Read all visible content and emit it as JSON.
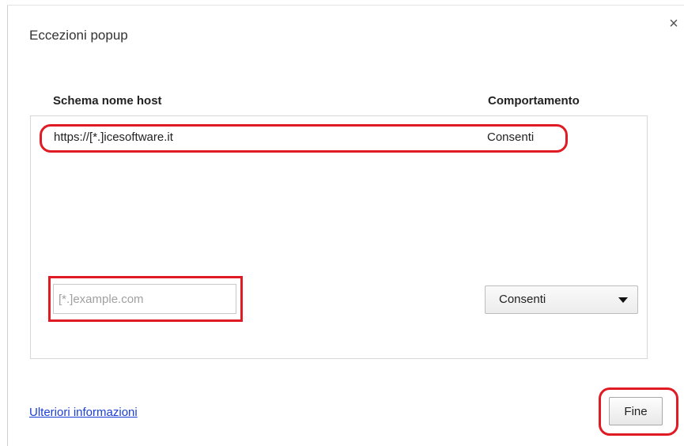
{
  "dialog": {
    "title": "Eccezioni popup",
    "close_icon": "×"
  },
  "table": {
    "columns": {
      "host": "Schema nome host",
      "behavior": "Comportamento"
    },
    "rows": [
      {
        "host": "https://[*.]icesoftware.it",
        "behavior": "Consenti"
      }
    ]
  },
  "new_exception": {
    "host_placeholder": "[*.]example.com",
    "host_value": "",
    "behavior_selected": "Consenti"
  },
  "footer": {
    "more_info_label": "Ulteriori informazioni",
    "done_label": "Fine"
  },
  "colors": {
    "annotation": "#e01b24",
    "link": "#1a3fd6"
  }
}
